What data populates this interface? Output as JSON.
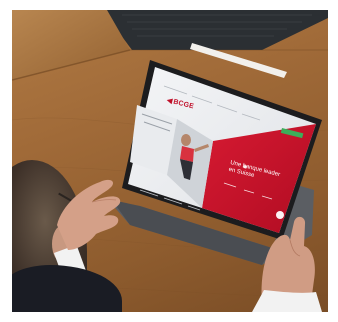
{
  "photo": {
    "description_visible_text": {
      "brand": "BCGE",
      "headline_line1": "Une banque leader",
      "headline_line2": "en Suisse"
    },
    "colors": {
      "table_wood": "#a06a38",
      "brand_red": "#c8102e",
      "tablet_frame": "#1c1c1e",
      "case_gray": "#5a5c60",
      "cta_green": "#3cae5a"
    }
  }
}
